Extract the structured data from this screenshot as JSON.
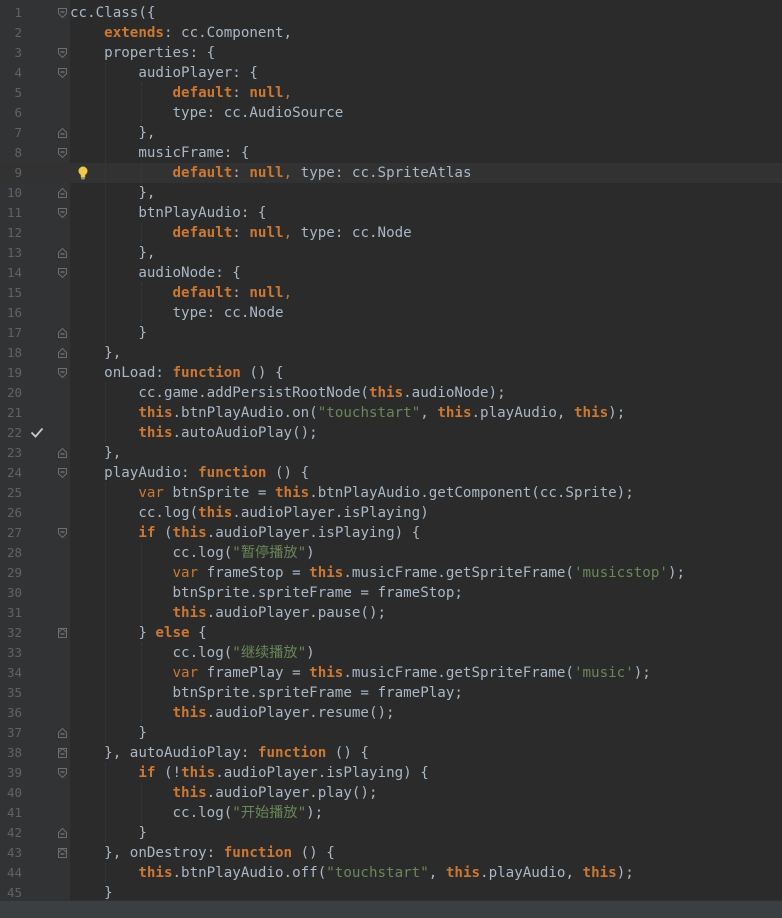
{
  "editor": {
    "current_line": 9,
    "line_numbers": [
      "1",
      "2",
      "3",
      "4",
      "5",
      "6",
      "7",
      "8",
      "9",
      "10",
      "11",
      "12",
      "13",
      "14",
      "15",
      "16",
      "17",
      "18",
      "19",
      "20",
      "21",
      "22",
      "23",
      "24",
      "25",
      "26",
      "27",
      "28",
      "29",
      "30",
      "31",
      "32",
      "33",
      "34",
      "35",
      "36",
      "37",
      "38",
      "39",
      "40",
      "41",
      "42",
      "43",
      "44",
      "45"
    ],
    "lines": [
      [
        {
          "t": "cc.Class({",
          "c": "p"
        }
      ],
      [
        {
          "t": "    ",
          "c": "p"
        },
        {
          "t": "extends",
          "c": "kw"
        },
        {
          "t": ": cc.Component,",
          "c": "p"
        }
      ],
      [
        {
          "t": "    properties: {",
          "c": "p"
        }
      ],
      [
        {
          "t": "        audioPlayer: {",
          "c": "p"
        }
      ],
      [
        {
          "t": "            ",
          "c": "p"
        },
        {
          "t": "default",
          "c": "kw"
        },
        {
          "t": ": ",
          "c": "p"
        },
        {
          "t": "null",
          "c": "kw"
        },
        {
          "t": ",",
          "c": "kwn"
        }
      ],
      [
        {
          "t": "            type: cc.AudioSource",
          "c": "p"
        }
      ],
      [
        {
          "t": "        },",
          "c": "p"
        }
      ],
      [
        {
          "t": "        musicFrame: {",
          "c": "p"
        }
      ],
      [
        {
          "t": "            ",
          "c": "p"
        },
        {
          "t": "default",
          "c": "kw"
        },
        {
          "t": ": ",
          "c": "p"
        },
        {
          "t": "null",
          "c": "kw"
        },
        {
          "t": ",",
          "c": "kwn"
        },
        {
          "t": " type: cc.SpriteAtlas",
          "c": "p"
        }
      ],
      [
        {
          "t": "        },",
          "c": "p"
        }
      ],
      [
        {
          "t": "        btnPlayAudio: {",
          "c": "p"
        }
      ],
      [
        {
          "t": "            ",
          "c": "p"
        },
        {
          "t": "default",
          "c": "kw"
        },
        {
          "t": ": ",
          "c": "p"
        },
        {
          "t": "null",
          "c": "kw"
        },
        {
          "t": ",",
          "c": "kwn"
        },
        {
          "t": " type: cc.Node",
          "c": "p"
        }
      ],
      [
        {
          "t": "        },",
          "c": "p"
        }
      ],
      [
        {
          "t": "        audioNode: {",
          "c": "p"
        }
      ],
      [
        {
          "t": "            ",
          "c": "p"
        },
        {
          "t": "default",
          "c": "kw"
        },
        {
          "t": ": ",
          "c": "p"
        },
        {
          "t": "null",
          "c": "kw"
        },
        {
          "t": ",",
          "c": "kwn"
        }
      ],
      [
        {
          "t": "            type: cc.Node",
          "c": "p"
        }
      ],
      [
        {
          "t": "        }",
          "c": "p"
        }
      ],
      [
        {
          "t": "    },",
          "c": "p"
        }
      ],
      [
        {
          "t": "    onLoad: ",
          "c": "p"
        },
        {
          "t": "function",
          "c": "kw"
        },
        {
          "t": " () {",
          "c": "p"
        }
      ],
      [
        {
          "t": "        cc.game.addPersistRootNode(",
          "c": "p"
        },
        {
          "t": "this",
          "c": "kw"
        },
        {
          "t": ".audioNode);",
          "c": "p"
        }
      ],
      [
        {
          "t": "        ",
          "c": "p"
        },
        {
          "t": "this",
          "c": "kw"
        },
        {
          "t": ".btnPlayAudio.on(",
          "c": "p"
        },
        {
          "t": "\"touchstart\"",
          "c": "str"
        },
        {
          "t": ", ",
          "c": "p"
        },
        {
          "t": "this",
          "c": "kw"
        },
        {
          "t": ".playAudio, ",
          "c": "p"
        },
        {
          "t": "this",
          "c": "kw"
        },
        {
          "t": ");",
          "c": "p"
        }
      ],
      [
        {
          "t": "        ",
          "c": "p"
        },
        {
          "t": "this",
          "c": "kw"
        },
        {
          "t": ".autoAudioPlay();",
          "c": "p"
        }
      ],
      [
        {
          "t": "    },",
          "c": "p"
        }
      ],
      [
        {
          "t": "    playAudio: ",
          "c": "p"
        },
        {
          "t": "function",
          "c": "kw"
        },
        {
          "t": " () {",
          "c": "p"
        }
      ],
      [
        {
          "t": "        ",
          "c": "p"
        },
        {
          "t": "var",
          "c": "kwn"
        },
        {
          "t": " btnSprite = ",
          "c": "p"
        },
        {
          "t": "this",
          "c": "kw"
        },
        {
          "t": ".btnPlayAudio.getComponent(cc.Sprite);",
          "c": "p"
        }
      ],
      [
        {
          "t": "        cc.log(",
          "c": "p"
        },
        {
          "t": "this",
          "c": "kw"
        },
        {
          "t": ".audioPlayer.isPlaying)",
          "c": "p"
        }
      ],
      [
        {
          "t": "        ",
          "c": "p"
        },
        {
          "t": "if",
          "c": "kw"
        },
        {
          "t": " (",
          "c": "p"
        },
        {
          "t": "this",
          "c": "kw"
        },
        {
          "t": ".audioPlayer.isPlaying) {",
          "c": "p"
        }
      ],
      [
        {
          "t": "            cc.log(",
          "c": "p"
        },
        {
          "t": "\"暂停播放\"",
          "c": "str"
        },
        {
          "t": ")",
          "c": "p"
        }
      ],
      [
        {
          "t": "            ",
          "c": "p"
        },
        {
          "t": "var",
          "c": "kwn"
        },
        {
          "t": " frameStop = ",
          "c": "p"
        },
        {
          "t": "this",
          "c": "kw"
        },
        {
          "t": ".musicFrame.getSpriteFrame(",
          "c": "p"
        },
        {
          "t": "'musicstop'",
          "c": "str"
        },
        {
          "t": ");",
          "c": "p"
        }
      ],
      [
        {
          "t": "            btnSprite.spriteFrame = frameStop;",
          "c": "p"
        }
      ],
      [
        {
          "t": "            ",
          "c": "p"
        },
        {
          "t": "this",
          "c": "kw"
        },
        {
          "t": ".audioPlayer.pause();",
          "c": "p"
        }
      ],
      [
        {
          "t": "        } ",
          "c": "p"
        },
        {
          "t": "else",
          "c": "kw"
        },
        {
          "t": " {",
          "c": "p"
        }
      ],
      [
        {
          "t": "            cc.log(",
          "c": "p"
        },
        {
          "t": "\"继续播放\"",
          "c": "str"
        },
        {
          "t": ")",
          "c": "p"
        }
      ],
      [
        {
          "t": "            ",
          "c": "p"
        },
        {
          "t": "var",
          "c": "kwn"
        },
        {
          "t": " framePlay = ",
          "c": "p"
        },
        {
          "t": "this",
          "c": "kw"
        },
        {
          "t": ".musicFrame.getSpriteFrame(",
          "c": "p"
        },
        {
          "t": "'music'",
          "c": "str"
        },
        {
          "t": ");",
          "c": "p"
        }
      ],
      [
        {
          "t": "            btnSprite.spriteFrame = framePlay;",
          "c": "p"
        }
      ],
      [
        {
          "t": "            ",
          "c": "p"
        },
        {
          "t": "this",
          "c": "kw"
        },
        {
          "t": ".audioPlayer.resume();",
          "c": "p"
        }
      ],
      [
        {
          "t": "        }",
          "c": "p"
        }
      ],
      [
        {
          "t": "    }, autoAudioPlay: ",
          "c": "p"
        },
        {
          "t": "function",
          "c": "kw"
        },
        {
          "t": " () {",
          "c": "p"
        }
      ],
      [
        {
          "t": "        ",
          "c": "p"
        },
        {
          "t": "if",
          "c": "kw"
        },
        {
          "t": " (!",
          "c": "p"
        },
        {
          "t": "this",
          "c": "kw"
        },
        {
          "t": ".audioPlayer.isPlaying) {",
          "c": "p"
        }
      ],
      [
        {
          "t": "            ",
          "c": "p"
        },
        {
          "t": "this",
          "c": "kw"
        },
        {
          "t": ".audioPlayer.play();",
          "c": "p"
        }
      ],
      [
        {
          "t": "            cc.log(",
          "c": "p"
        },
        {
          "t": "\"开始播放\"",
          "c": "str"
        },
        {
          "t": ");",
          "c": "p"
        }
      ],
      [
        {
          "t": "        }",
          "c": "p"
        }
      ],
      [
        {
          "t": "    }, onDestroy: ",
          "c": "p"
        },
        {
          "t": "function",
          "c": "kw"
        },
        {
          "t": " () {",
          "c": "p"
        }
      ],
      [
        {
          "t": "        ",
          "c": "p"
        },
        {
          "t": "this",
          "c": "kw"
        },
        {
          "t": ".btnPlayAudio.off(",
          "c": "p"
        },
        {
          "t": "\"touchstart\"",
          "c": "str"
        },
        {
          "t": ", ",
          "c": "p"
        },
        {
          "t": "this",
          "c": "kw"
        },
        {
          "t": ".playAudio, ",
          "c": "p"
        },
        {
          "t": "this",
          "c": "kw"
        },
        {
          "t": ");",
          "c": "p"
        }
      ],
      [
        {
          "t": "    }",
          "c": "p"
        }
      ]
    ],
    "fold_open_lines": [
      1,
      3,
      4,
      8,
      11,
      14,
      19,
      24,
      27,
      32,
      38,
      39,
      43
    ],
    "fold_close_lines": [
      7,
      10,
      13,
      17,
      18,
      23,
      32,
      37,
      38,
      42,
      43
    ],
    "gutter_icons": [
      {
        "line": 9,
        "icon": "lightbulb-icon"
      },
      {
        "line": 22,
        "icon": "checkmark-icon"
      }
    ],
    "colors": {
      "background": "#2b2b2b",
      "current_line": "#323232",
      "text": "#a9b7c6",
      "keyword": "#cc7832",
      "string": "#6a8759",
      "line_number": "#606366"
    }
  }
}
